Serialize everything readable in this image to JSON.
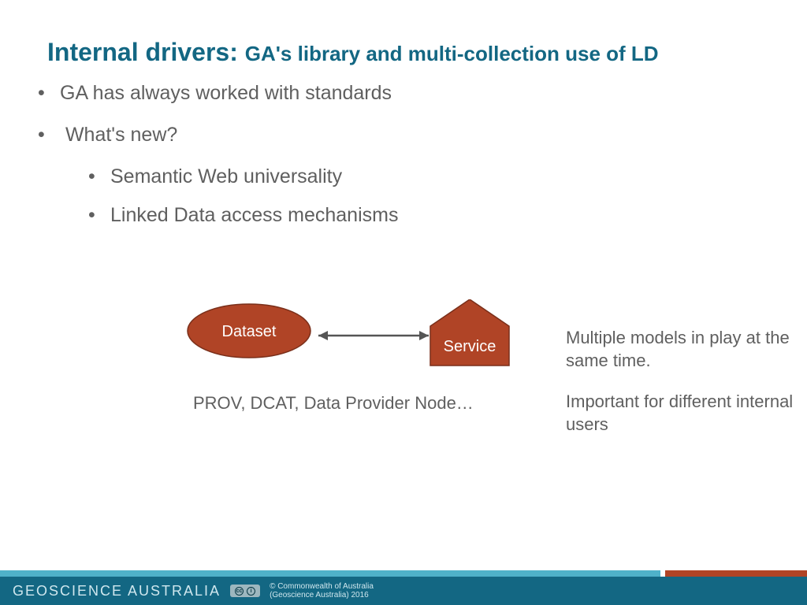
{
  "title": {
    "main": "Internal drivers: ",
    "sub": "GA's library and multi-collection use of LD"
  },
  "bullets": [
    "GA has always worked with standards",
    "What's new?"
  ],
  "sub_bullets": [
    "Semantic Web universality",
    "Linked Data access mechanisms"
  ],
  "diagram": {
    "left_node": "Dataset",
    "right_node": "Service",
    "caption": "PROV, DCAT, Data Provider Node…"
  },
  "side_notes": {
    "note1": "Multiple models in play at the same time.",
    "note2": "Important for different internal users"
  },
  "footer": {
    "org": "GEOSCIENCE AUSTRALIA",
    "cc_text1": "cc",
    "cc_text2": "i",
    "copyright_line1": "© Commonwealth of Australia",
    "copyright_line2": "(Geoscience Australia) 2016"
  }
}
